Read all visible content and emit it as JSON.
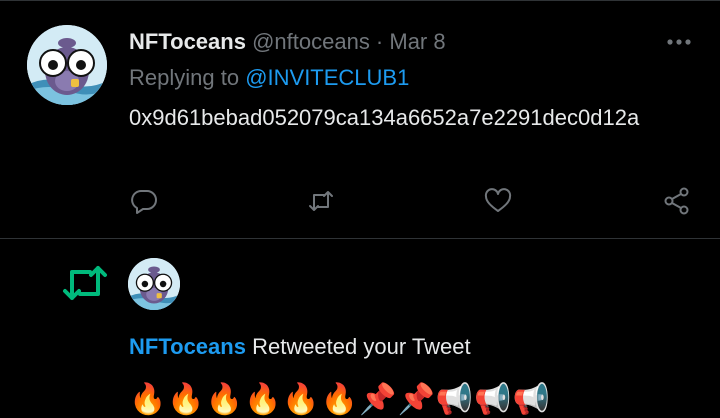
{
  "tweet": {
    "display_name": "NFToceans",
    "handle": "@nftoceans",
    "separator": " · ",
    "date": "Mar 8",
    "replying_to_prefix": "Replying to ",
    "replying_to_handle": "@INVITECLUB1",
    "text": "0x9d61bebad052079ca134a6652a7e2291dec0d12a",
    "actions": [
      "reply-icon",
      "retweet-icon",
      "like-icon",
      "share-icon"
    ]
  },
  "notification": {
    "display_name": "NFToceans",
    "action_text": "Retweeted your Tweet",
    "preview_emojis": "🔥🔥🔥🔥🔥🔥📌📌📢📢📢"
  },
  "colors": {
    "background": "#000000",
    "text_primary": "#e7e9ea",
    "text_muted": "#71767b",
    "accent_blue": "#1d9bf0",
    "retweet_green": "#00ba7c",
    "divider": "#2f3336"
  }
}
